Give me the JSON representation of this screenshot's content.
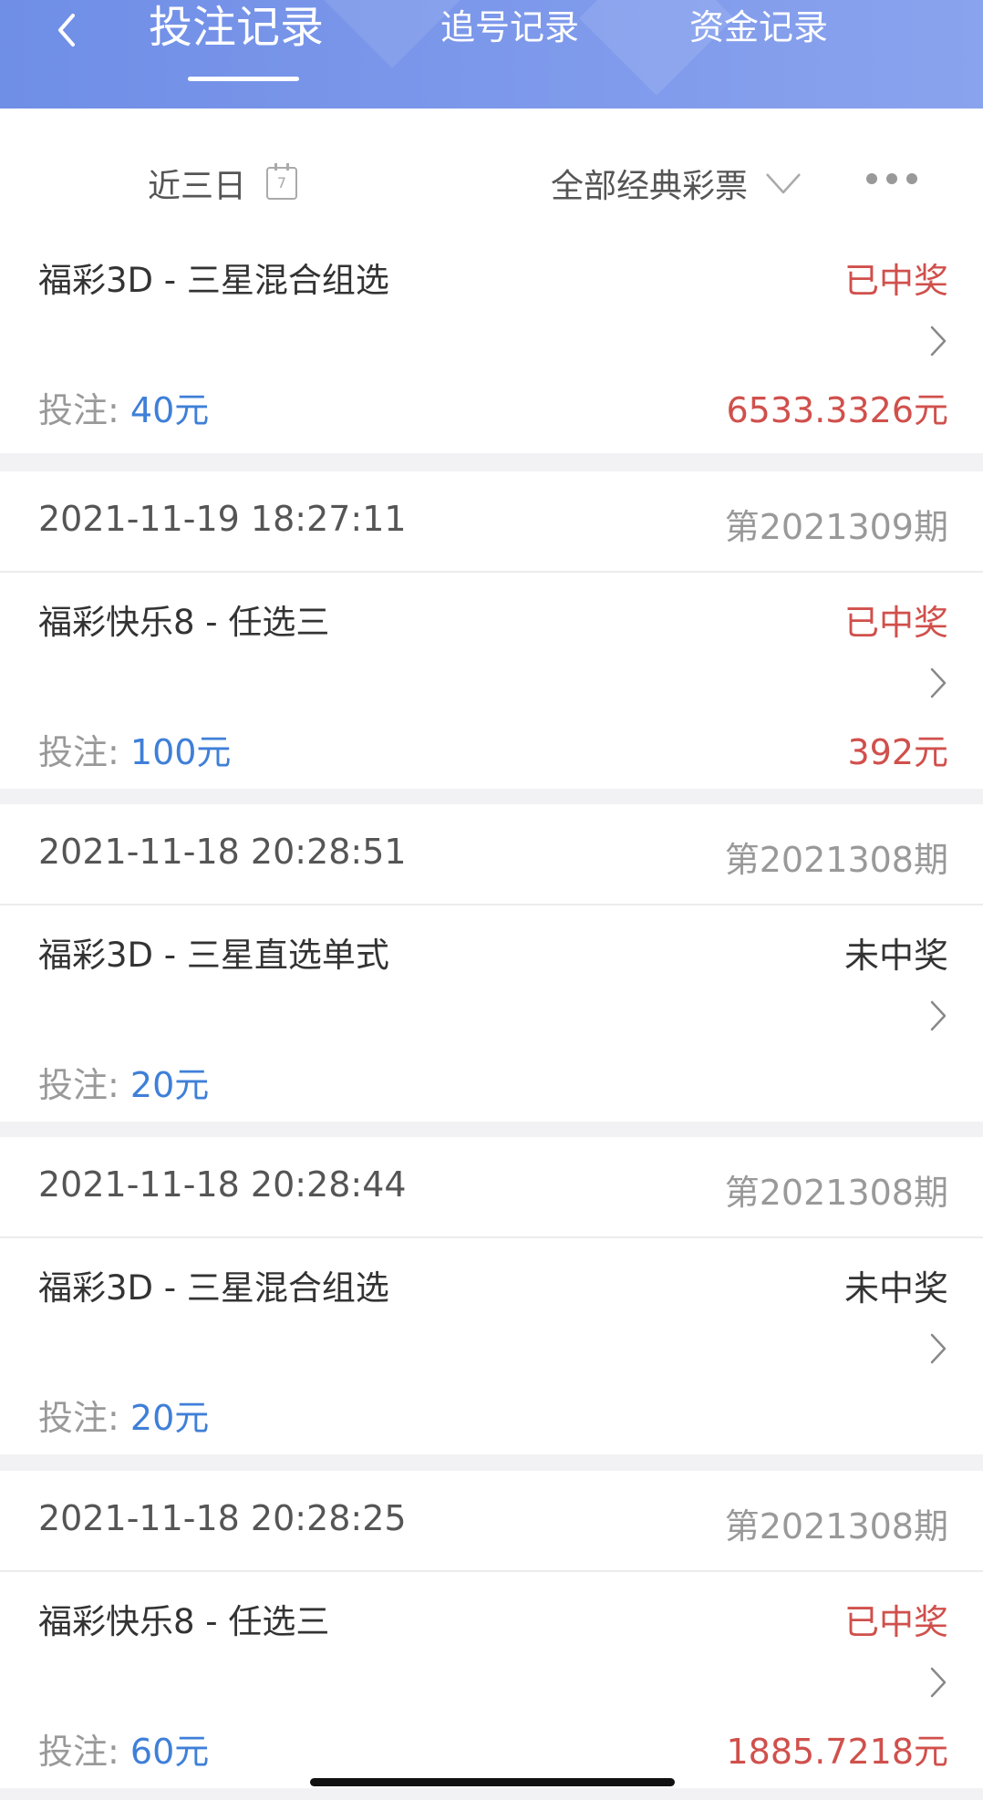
{
  "header": {
    "tabs": [
      "投注记录",
      "追号记录",
      "资金记录"
    ],
    "active_tab": 0
  },
  "filter": {
    "date_label": "近三日",
    "calendar_day": "7",
    "type_label": "全部经典彩票"
  },
  "bet_label": "投注: ",
  "records": [
    {
      "time": "",
      "issue": "",
      "name": "福彩3D - 三星混合组选",
      "status": "已中奖",
      "won": true,
      "amount": "40元",
      "prize": "6533.3326元"
    },
    {
      "time": "2021-11-19 18:27:11",
      "issue": "第2021309期",
      "name": "福彩快乐8 - 任选三",
      "status": "已中奖",
      "won": true,
      "amount": "100元",
      "prize": "392元"
    },
    {
      "time": "2021-11-18 20:28:51",
      "issue": "第2021308期",
      "name": "福彩3D - 三星直选单式",
      "status": "未中奖",
      "won": false,
      "amount": "20元",
      "prize": ""
    },
    {
      "time": "2021-11-18 20:28:44",
      "issue": "第2021308期",
      "name": "福彩3D - 三星混合组选",
      "status": "未中奖",
      "won": false,
      "amount": "20元",
      "prize": ""
    },
    {
      "time": "2021-11-18 20:28:25",
      "issue": "第2021308期",
      "name": "福彩快乐8 - 任选三",
      "status": "已中奖",
      "won": true,
      "amount": "60元",
      "prize": "1885.7218元"
    }
  ],
  "colors": {
    "header": "#7b97ea",
    "win": "#d0504c",
    "amount": "#3f7fd8"
  }
}
